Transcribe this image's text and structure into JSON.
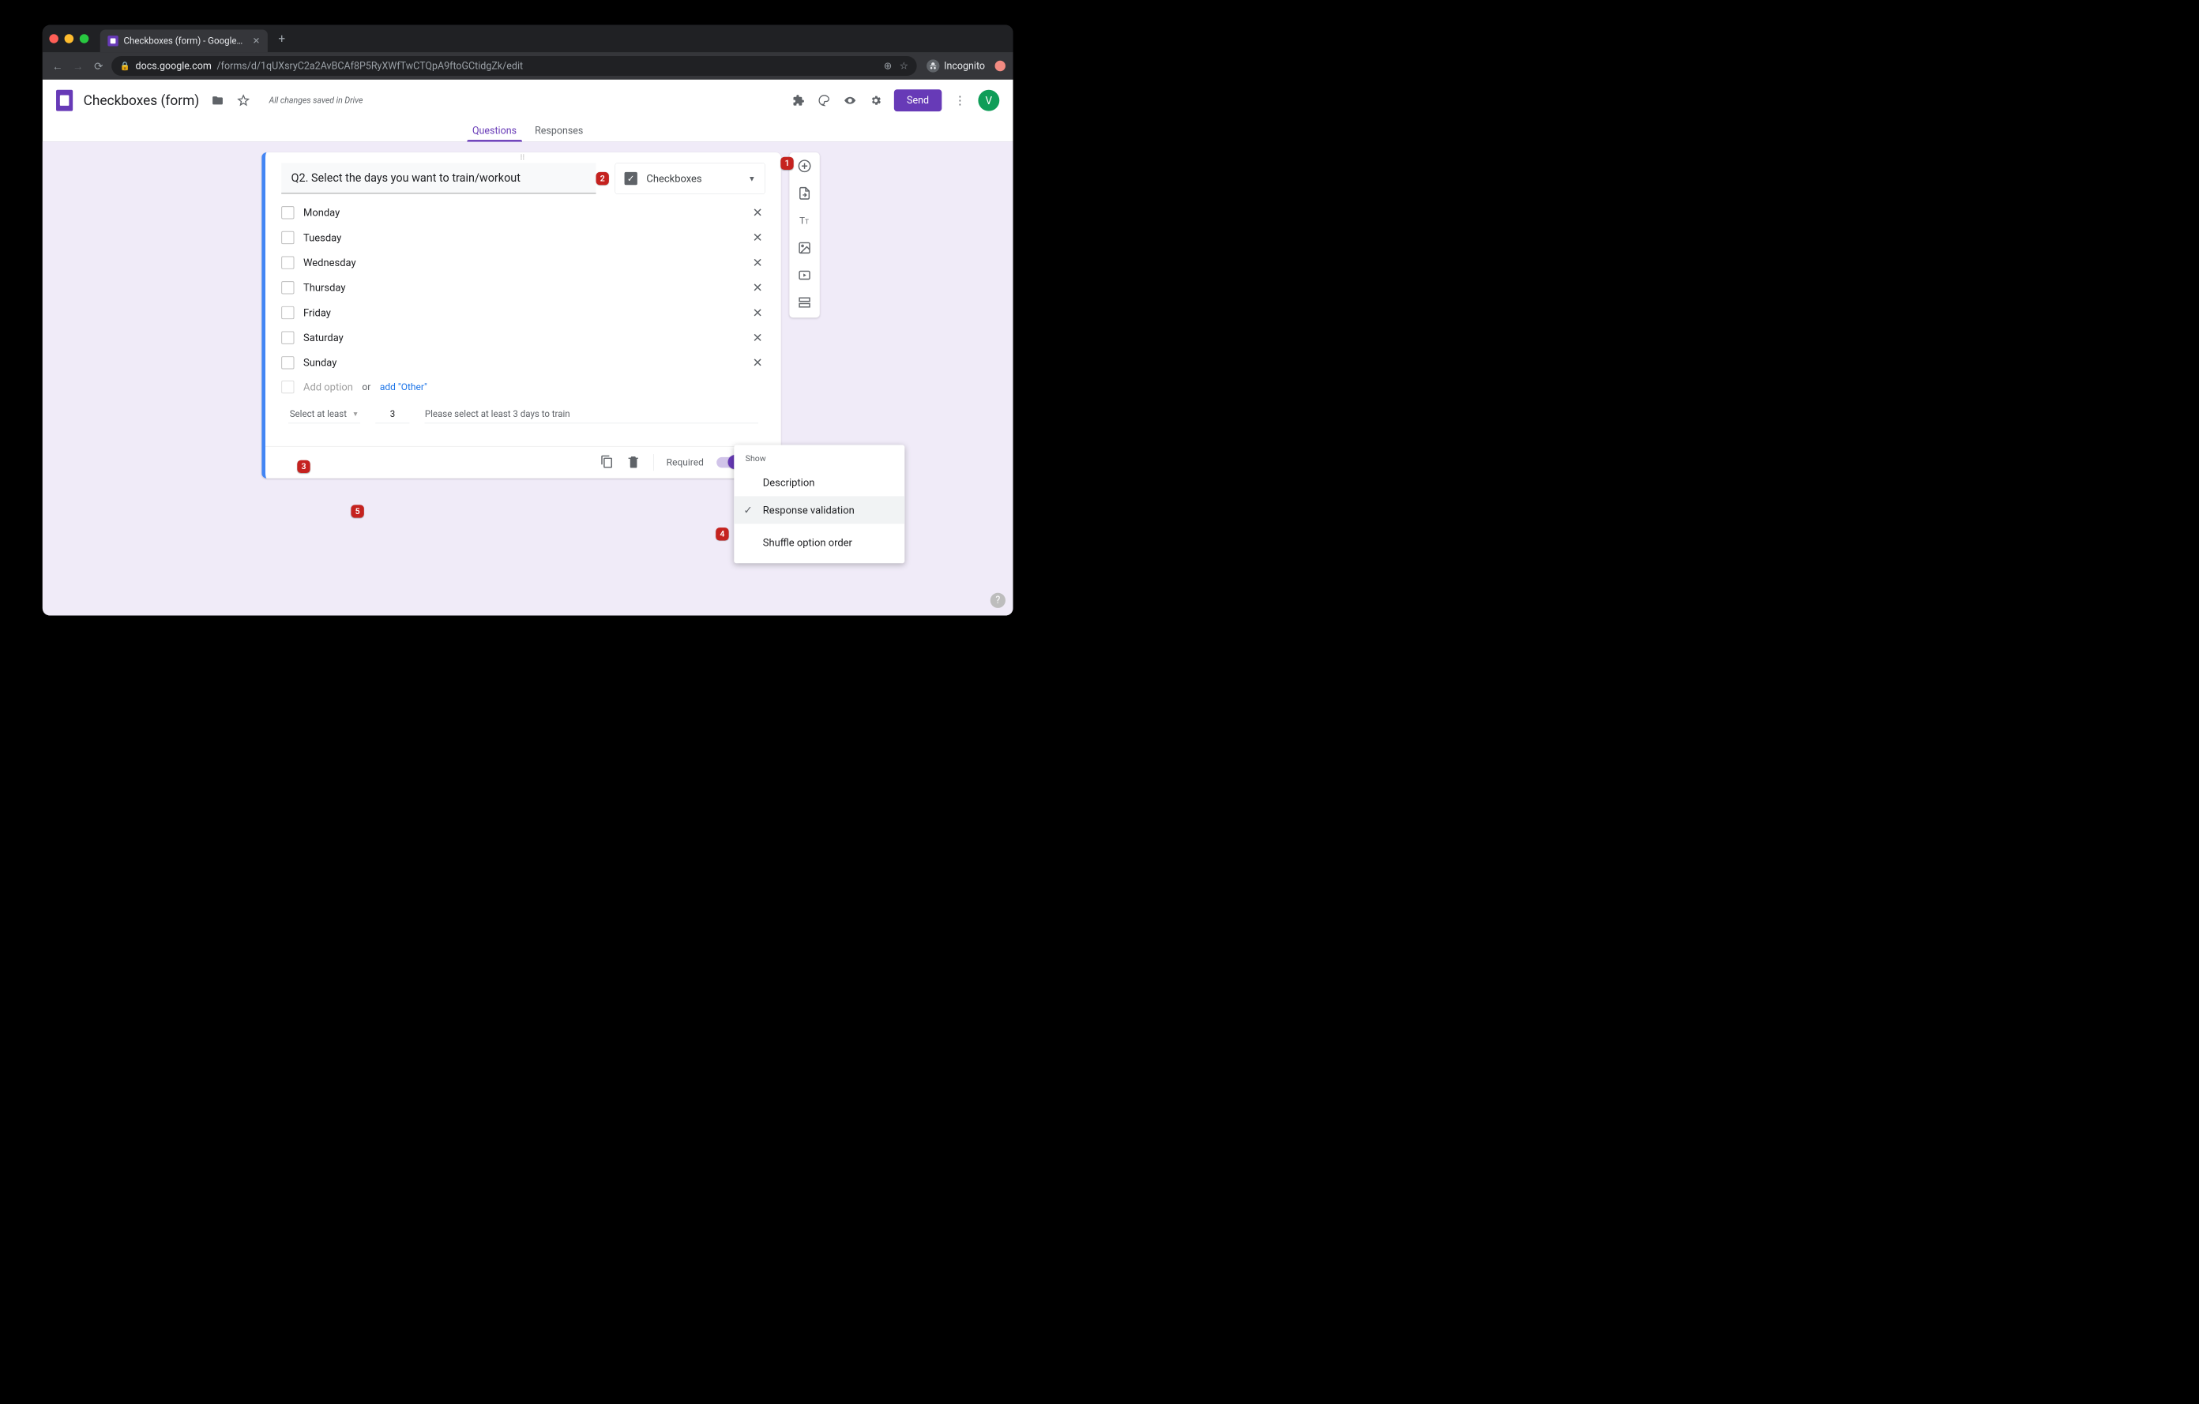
{
  "browser": {
    "tab_title": "Checkboxes (form) - Google Fo",
    "url_host": "docs.google.com",
    "url_path": "/forms/d/1qUXsryC2a2AvBCAf8P5RyXWfTwCTQpA9ftoGCtidgZk/edit",
    "incognito_label": "Incognito"
  },
  "header": {
    "doc_title": "Checkboxes (form)",
    "saved_status": "All changes saved in Drive",
    "send_label": "Send",
    "avatar_letter": "V"
  },
  "tabs": {
    "questions": "Questions",
    "responses": "Responses"
  },
  "question": {
    "title": "Q2. Select the days you want to train/workout",
    "type_label": "Checkboxes",
    "options": [
      "Monday",
      "Tuesday",
      "Wednesday",
      "Thursday",
      "Friday",
      "Saturday",
      "Sunday"
    ],
    "add_option_placeholder": "Add option",
    "or_label": "or",
    "add_other_label": "add \"Other\"",
    "validation": {
      "rule_label": "Select at least",
      "number": "3",
      "error_text": "Please select at least 3 days to train"
    },
    "required_label": "Required"
  },
  "menu": {
    "header": "Show",
    "items": {
      "description": "Description",
      "validation": "Response validation",
      "shuffle": "Shuffle option order"
    }
  },
  "badges": {
    "b1": "1",
    "b2": "2",
    "b3": "3",
    "b4": "4",
    "b5": "5"
  }
}
